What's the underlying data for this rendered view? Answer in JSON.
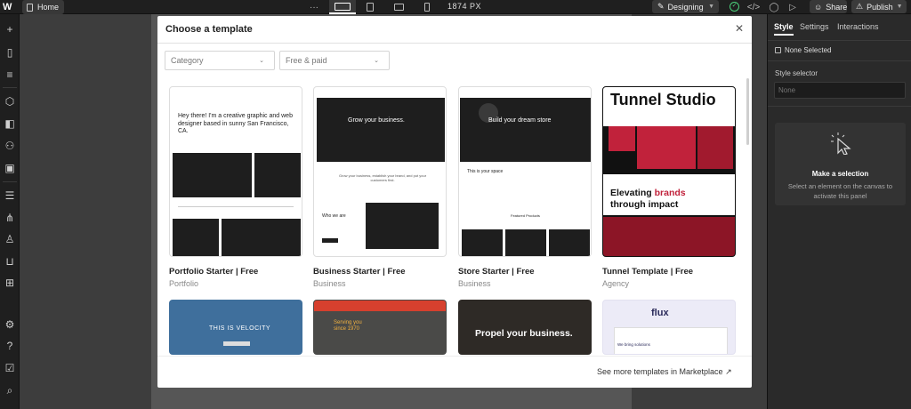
{
  "topbar": {
    "logo_text": "W",
    "home_label": "Home",
    "more_label": "···",
    "breakpoint_readout": "1874 PX",
    "mode_label": "Designing",
    "share_label": "Share",
    "publish_label": "Publish"
  },
  "right_panel": {
    "tabs": [
      "Style",
      "Settings",
      "Interactions"
    ],
    "none_selected": "None Selected",
    "style_selector_label": "Style selector",
    "style_selector_placeholder": "None",
    "make_selection_title": "Make a selection",
    "make_selection_desc": "Select an element on the canvas to activate this panel"
  },
  "modal": {
    "title": "Choose a template",
    "category_filter": "Category",
    "price_filter": "Free & paid",
    "see_more": "See more templates in Marketplace ↗",
    "templates": [
      {
        "name": "Portfolio Starter  |  Free",
        "category": "Portfolio"
      },
      {
        "name": "Business Starter  |  Free",
        "category": "Business"
      },
      {
        "name": "Store Starter  |  Free",
        "category": "Business"
      },
      {
        "name": "Tunnel Template  |  Free",
        "category": "Agency"
      }
    ],
    "thumb_texts": {
      "portfolio_headline": "Hey there! I'm a creative graphic and web designer based in sunny San Francisco, CA.",
      "business_headline": "Grow your business.",
      "business_sub": "Grow your business, establish your brand, and put your customers first.",
      "business_who": "Who we are",
      "store_headline": "Build your dream store",
      "store_space": "This is your space",
      "store_featured": "Featured Products",
      "tunnel_title": "Tunnel Studio",
      "tunnel_elevating": "Elevating ",
      "tunnel_brands": "brands",
      "tunnel_impact": "through impact",
      "velocity": "THIS IS VELOCITY",
      "serving": "Serving you since 1970",
      "propel": "Propel your business.",
      "flux": "flux",
      "flux_sub": "We bring solutions"
    }
  },
  "colors": {
    "accent_red": "#c1223b",
    "success_green": "#4bd07a"
  }
}
